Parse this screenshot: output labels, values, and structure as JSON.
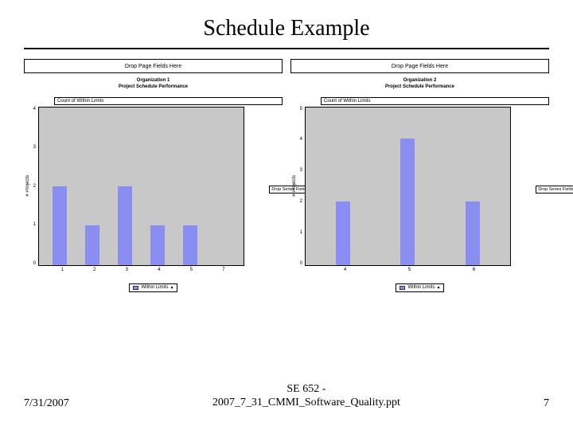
{
  "slide": {
    "title": "Schedule Example",
    "date": "7/31/2007",
    "footer_center_line1": "SE 652 -",
    "footer_center_line2": "2007_7_31_CMMI_Software_Quality.ppt",
    "page_number": "7"
  },
  "left": {
    "drop_page": "Drop Page Fields Here",
    "org": "Organization 1",
    "subtitle": "Project Schedule Performance",
    "count_label": "Count of Within Limits",
    "side_drop": "Drop Series Fields Here",
    "legend": "Within Limits",
    "dropdown_glyph": "▾",
    "ylabel": "# Projects",
    "ymax": 4,
    "yticks": [
      "4",
      "3",
      "2",
      "1",
      "0"
    ],
    "xticks": [
      "1",
      "2",
      "3",
      "4",
      "5",
      "7"
    ]
  },
  "right": {
    "drop_page": "Drop Page Fields Here",
    "org": "Organization 2",
    "subtitle": "Project Schedule Performance",
    "count_label": "Count of Within Limits",
    "side_drop": "Drop Series Fields Here",
    "legend": "Within Limits",
    "dropdown_glyph": "▾",
    "ylabel": "# Projects",
    "ymax": 5,
    "yticks": [
      "5",
      "4",
      "3",
      "2",
      "1",
      "0"
    ],
    "xticks": [
      "4",
      "5",
      "6"
    ]
  },
  "chart_data": [
    {
      "type": "bar",
      "title": "Organization 1 — Project Schedule Performance",
      "xlabel": "",
      "ylabel": "# Projects",
      "ylim": [
        0,
        4
      ],
      "categories": [
        "1",
        "2",
        "3",
        "4",
        "5",
        "7"
      ],
      "values": [
        2,
        1,
        2,
        1,
        1,
        0
      ]
    },
    {
      "type": "bar",
      "title": "Organization 2 — Project Schedule Performance",
      "xlabel": "",
      "ylabel": "# Projects",
      "ylim": [
        0,
        5
      ],
      "categories": [
        "4",
        "5",
        "6"
      ],
      "values": [
        2,
        4,
        2
      ]
    }
  ]
}
